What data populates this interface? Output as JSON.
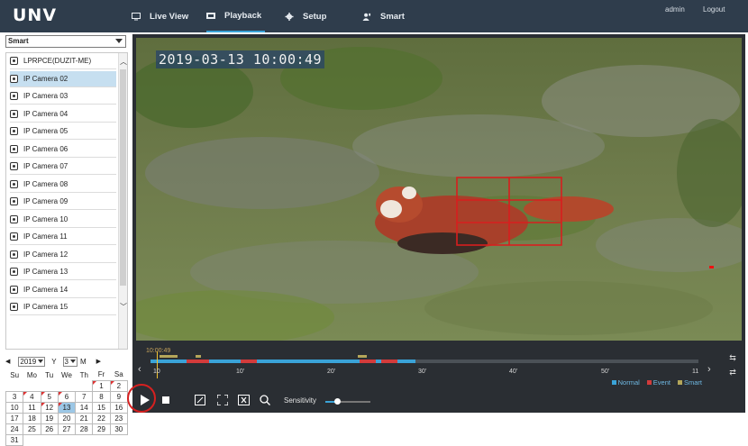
{
  "brand": {
    "logo_text": "unv"
  },
  "nav": {
    "items": [
      {
        "label": "Live View",
        "icon": "monitor-icon"
      },
      {
        "label": "Playback",
        "icon": "playback-icon",
        "active": true
      },
      {
        "label": "Setup",
        "icon": "gear-icon"
      },
      {
        "label": "Smart",
        "icon": "smart-user-icon"
      }
    ],
    "user": "admin",
    "logout": "Logout"
  },
  "left": {
    "mode_select": "Smart",
    "devices": [
      {
        "label": "LPRPCE(DUZIT-ME)",
        "selected": false
      },
      {
        "label": "IP Camera 02",
        "selected": true
      },
      {
        "label": "IP Camera 03",
        "selected": false
      },
      {
        "label": "IP Camera 04",
        "selected": false
      },
      {
        "label": "IP Camera 05",
        "selected": false
      },
      {
        "label": "IP Camera 06",
        "selected": false
      },
      {
        "label": "IP Camera 07",
        "selected": false
      },
      {
        "label": "IP Camera 08",
        "selected": false
      },
      {
        "label": "IP Camera 09",
        "selected": false
      },
      {
        "label": "IP Camera 10",
        "selected": false
      },
      {
        "label": "IP Camera 11",
        "selected": false
      },
      {
        "label": "IP Camera 12",
        "selected": false
      },
      {
        "label": "IP Camera 13",
        "selected": false
      },
      {
        "label": "IP Camera 14",
        "selected": false
      },
      {
        "label": "IP Camera 15",
        "selected": false
      }
    ],
    "calendar": {
      "prev": "◀",
      "year": "2019",
      "year_label": "Y",
      "month": "3",
      "month_label": "M",
      "next": "▶",
      "weekdays": [
        "Su",
        "Mo",
        "Tu",
        "We",
        "Th",
        "Fr",
        "Sa"
      ],
      "weeks": [
        [
          "",
          "",
          "",
          "",
          "",
          "1",
          "2"
        ],
        [
          "3",
          "4",
          "5",
          "6",
          "7",
          "8",
          "9"
        ],
        [
          "10",
          "11",
          "12",
          "13",
          "14",
          "15",
          "16"
        ],
        [
          "17",
          "18",
          "19",
          "20",
          "21",
          "22",
          "23"
        ],
        [
          "24",
          "25",
          "26",
          "27",
          "28",
          "29",
          "30"
        ],
        [
          "31",
          "",
          "",
          "",
          "",
          "",
          ""
        ]
      ],
      "recorded_days": [
        "1",
        "2",
        "4",
        "5",
        "6",
        "12",
        "13"
      ],
      "selected_day": "13"
    }
  },
  "player": {
    "osd_time": "2019-03-13  10:00:49",
    "timeline": {
      "current_time": "10:00:49",
      "ticks": [
        "10",
        "10'",
        "20'",
        "30'",
        "40'",
        "50'",
        "11"
      ],
      "nav_prev": "‹",
      "nav_next": "›",
      "legend": [
        {
          "label": "Normal",
          "color": "#3aa3d8"
        },
        {
          "label": "Event",
          "color": "#d33b3b"
        },
        {
          "label": "Smart",
          "color": "#b4a65a"
        }
      ]
    },
    "controls": {
      "sensitivity_label": "Sensitivity",
      "sensitivity_value": 0.25
    }
  }
}
